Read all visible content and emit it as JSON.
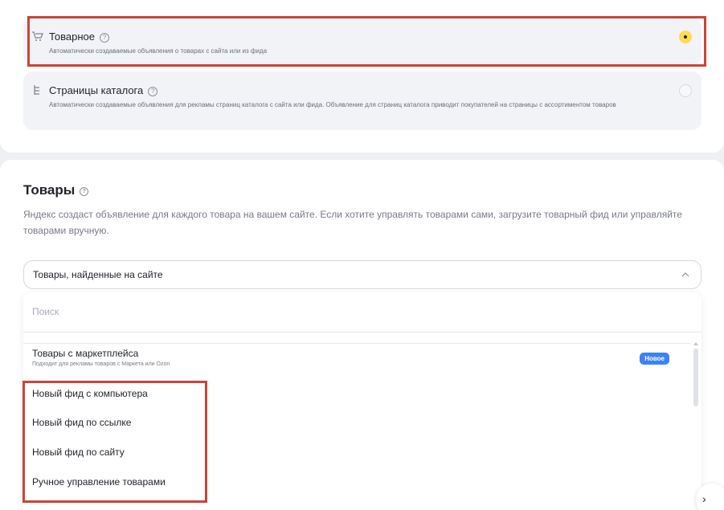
{
  "ad_types": {
    "product": {
      "title": "Товарное",
      "description": "Автоматически создаваемые объявления о товарах с сайта или из фида",
      "selected": true
    },
    "catalog": {
      "title": "Страницы каталога",
      "description": "Автоматически создаваемые объявления для рекламы страниц каталога с сайта или фида. Объявление для страниц каталога приводит покупателей на страницы с ассортиментом товаров",
      "selected": false
    }
  },
  "products": {
    "title": "Товары",
    "description": "Яндекс создаст объявление для каждого товара на вашем сайте. Если хотите управлять товарами сами, загрузите товарный фид или управляйте товарами вручную.",
    "select_value": "Товары, найденные на сайте",
    "search_placeholder": "Поиск",
    "options": [
      {
        "label": "Товары с маркетплейса",
        "sub": "Подходит для рекламы товаров с Маркета или Ozon",
        "badge": "Новое"
      },
      {
        "label": "Новый фид с компьютера"
      },
      {
        "label": "Новый фид по ссылке"
      },
      {
        "label": "Новый фид по сайту"
      },
      {
        "label": "Ручное управление товарами"
      }
    ]
  },
  "icons": {
    "cart": "cart-icon",
    "catalog": "catalog-tree-icon",
    "help": "question-circle-icon",
    "chevron": "chevron-up-icon",
    "next": "chevron-right-icon"
  },
  "colors": {
    "accent": "#ffdb4d",
    "badge": "#3b82f6",
    "highlight": "#c9443a"
  }
}
